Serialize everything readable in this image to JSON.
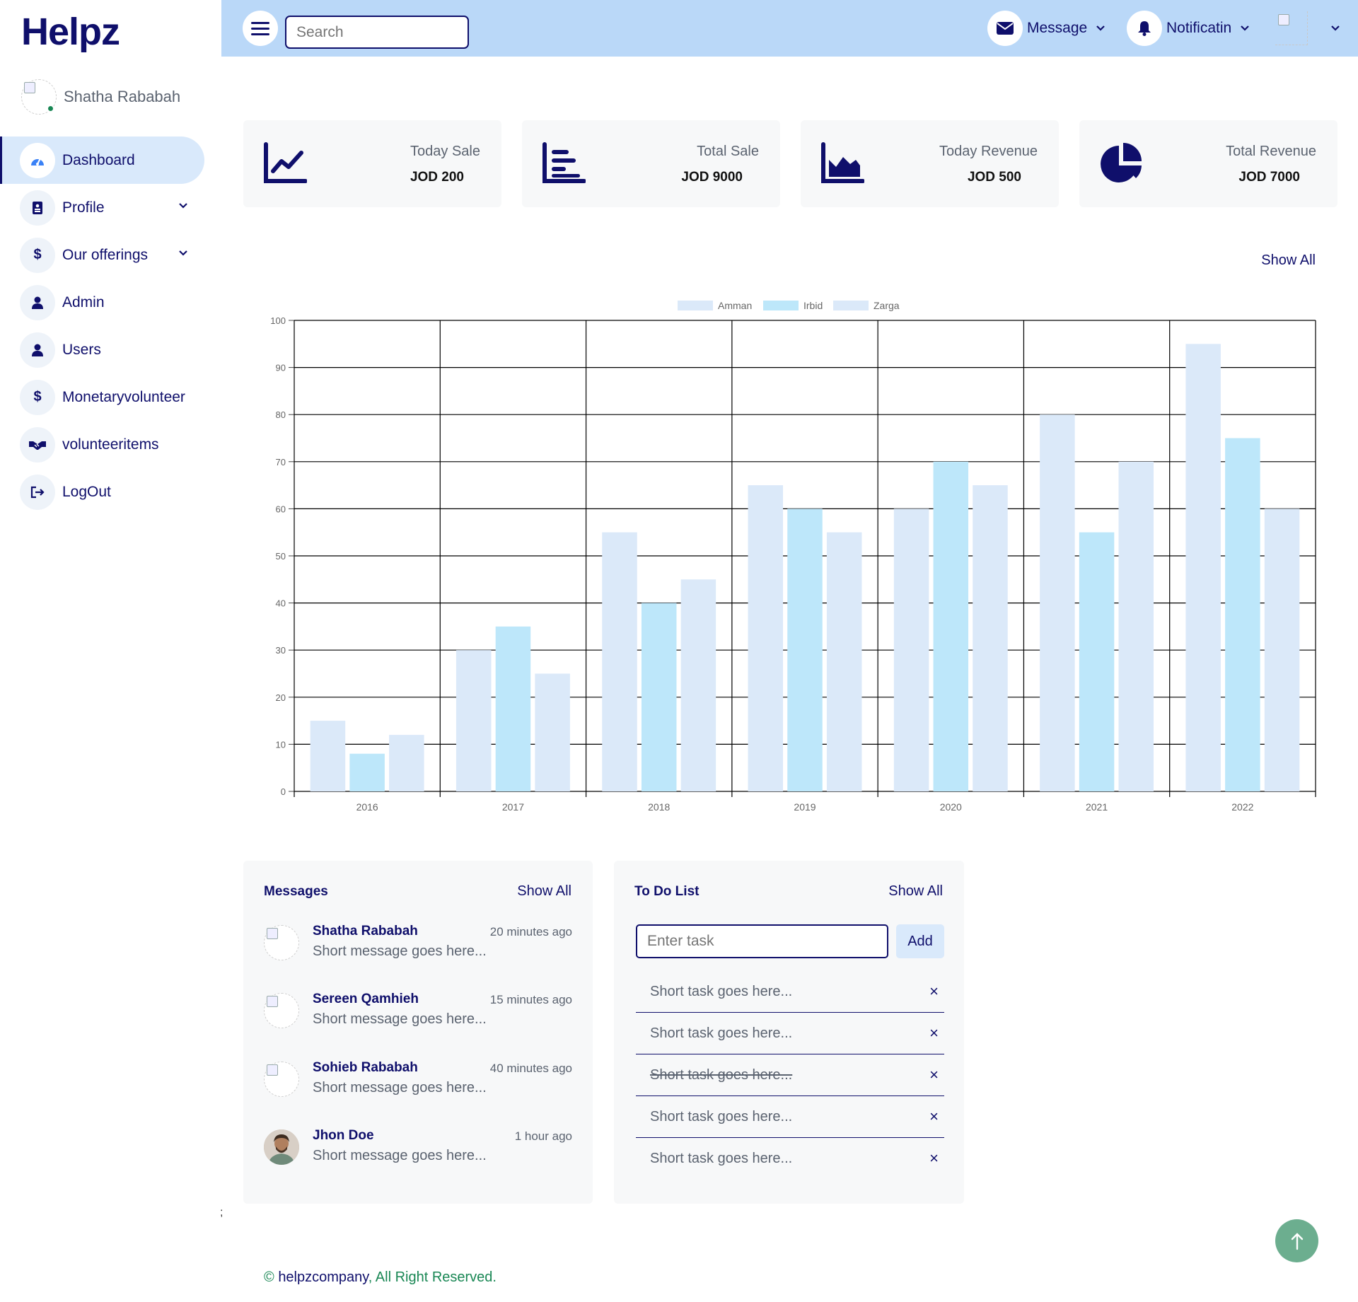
{
  "brand": "Helpz",
  "user": {
    "name": "Shatha Rababah",
    "status": "online"
  },
  "sidebar": {
    "items": [
      {
        "label": "Dashboard",
        "icon": "gauge-icon",
        "active": true,
        "has_submenu": false
      },
      {
        "label": "Profile",
        "icon": "id-card-icon",
        "active": false,
        "has_submenu": true
      },
      {
        "label": "Our offerings",
        "icon": "dollar-icon",
        "active": false,
        "has_submenu": true
      },
      {
        "label": "Admin",
        "icon": "user-icon",
        "active": false,
        "has_submenu": false
      },
      {
        "label": "Users",
        "icon": "user-icon",
        "active": false,
        "has_submenu": false
      },
      {
        "label": "Monetaryvolunteer",
        "icon": "dollar-icon",
        "active": false,
        "has_submenu": false
      },
      {
        "label": "volunteeritems",
        "icon": "handshake-icon",
        "active": false,
        "has_submenu": false
      },
      {
        "label": "LogOut",
        "icon": "logout-icon",
        "active": false,
        "has_submenu": false
      }
    ],
    "icons": {
      "Dashboard": "◔",
      "Profile": "▤",
      "Our offerings": "$",
      "Admin": "●",
      "Users": "●",
      "Monetaryvolunteer": "$",
      "volunteeritems": "⚭",
      "LogOut": "⇥"
    }
  },
  "topbar": {
    "search_placeholder": "Search",
    "message_label": "Message",
    "notification_label": "Notificatin"
  },
  "stats": [
    {
      "title": "Today Sale",
      "value": "JOD 200",
      "icon": "line-chart-icon"
    },
    {
      "title": "Total Sale",
      "value": "JOD 9000",
      "icon": "bar-chart-icon"
    },
    {
      "title": "Today Revenue",
      "value": "JOD 500",
      "icon": "area-chart-icon"
    },
    {
      "title": "Total Revenue",
      "value": "JOD 7000",
      "icon": "pie-chart-icon"
    }
  ],
  "chart_section": {
    "show_all": "Show All"
  },
  "chart_data": {
    "type": "bar",
    "categories": [
      "2016",
      "2017",
      "2018",
      "2019",
      "2020",
      "2021",
      "2022"
    ],
    "series": [
      {
        "name": "Amman",
        "color": "#dbe9f9",
        "values": [
          15,
          30,
          55,
          65,
          60,
          80,
          95
        ]
      },
      {
        "name": "Irbid",
        "color": "#bde7fa",
        "values": [
          8,
          35,
          40,
          60,
          70,
          55,
          75
        ]
      },
      {
        "name": "Zarga",
        "color": "#dbe9f9",
        "values": [
          12,
          25,
          45,
          55,
          65,
          70,
          60
        ]
      }
    ],
    "ylim": [
      0,
      100
    ],
    "yticks": [
      0,
      10,
      20,
      30,
      40,
      50,
      60,
      70,
      80,
      90,
      100
    ],
    "grid": true,
    "legend": "top-center"
  },
  "messages": {
    "title": "Messages",
    "show_all": "Show All",
    "items": [
      {
        "name": "Shatha Rababah",
        "time": "20 minutes ago",
        "text": "Short message goes here..."
      },
      {
        "name": "Sereen Qamhieh",
        "time": "15 minutes ago",
        "text": "Short message goes here..."
      },
      {
        "name": "Sohieb Rababah",
        "time": "40 minutes ago",
        "text": "Short message goes here..."
      },
      {
        "name": "Jhon Doe",
        "time": "1 hour ago",
        "text": "Short message goes here..."
      }
    ]
  },
  "todo": {
    "title": "To Do List",
    "show_all": "Show All",
    "input_placeholder": "Enter task",
    "add_label": "Add",
    "delete_glyph": "×",
    "tasks": [
      {
        "text": "Short task goes here...",
        "done": false
      },
      {
        "text": "Short task goes here...",
        "done": false
      },
      {
        "text": "Short task goes here...",
        "done": true
      },
      {
        "text": "Short task goes here...",
        "done": false
      },
      {
        "text": "Short task goes here...",
        "done": false
      }
    ]
  },
  "footer": {
    "copyright": "©",
    "company": "helpzcompany",
    "rights": ", All Right Reserved."
  },
  "stray_text": ";",
  "colors": {
    "navy": "#0f0f6b",
    "topbar": "#bad8f8",
    "active": "#d9e9fb",
    "green": "#198754",
    "backtop": "#6cae8f"
  }
}
